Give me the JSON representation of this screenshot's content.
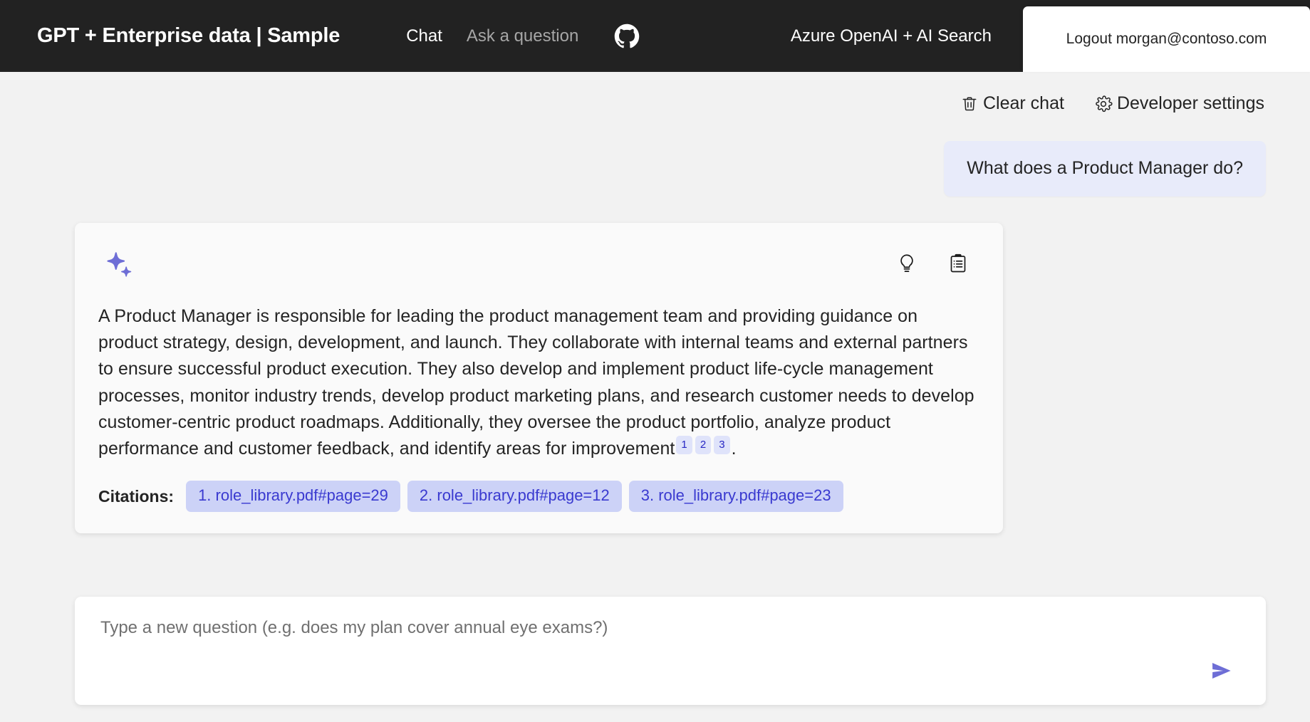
{
  "header": {
    "title": "GPT + Enterprise data | Sample",
    "nav": [
      {
        "label": "Chat",
        "active": true
      },
      {
        "label": "Ask a question",
        "active": false
      }
    ],
    "github_icon": "github-icon",
    "subtitle": "Azure OpenAI + AI Search",
    "logout_label": "Logout morgan@contoso.com"
  },
  "command_bar": {
    "clear_chat": {
      "label": "Clear chat",
      "icon": "trash-icon"
    },
    "developer_settings": {
      "label": "Developer settings",
      "icon": "gear-icon"
    }
  },
  "conversation": {
    "user_message": "What does a Product Manager do?",
    "answer": {
      "avatar_icon": "sparkle-icon",
      "actions": [
        {
          "name": "thought-process",
          "icon": "lightbulb-icon"
        },
        {
          "name": "supporting-content",
          "icon": "clipboard-icon"
        }
      ],
      "text_part_1": "A Product Manager is responsible for leading the product management team and providing guidance on product strategy, design, development, and launch. They collaborate with internal teams and external partners to ensure successful product execution. They also develop and implement product life-cycle management processes, monitor industry trends, develop product marketing plans, and research customer needs to develop customer-centric product roadmaps. Additionally, they oversee the product portfolio, analyze product performance and customer feedback, and identify areas for improvement",
      "sup_1": "1",
      "sup_2": "2",
      "sup_3": "3",
      "text_part_2": ".",
      "citations_label": "Citations:",
      "citations": [
        "1. role_library.pdf#page=29",
        "2. role_library.pdf#page=12",
        "3. role_library.pdf#page=23"
      ]
    }
  },
  "question_input": {
    "placeholder": "Type a new question (e.g. does my plan cover annual eye exams?)",
    "value": "",
    "send_icon": "send-arrow-icon"
  },
  "colors": {
    "header_bg": "#222222",
    "page_bg": "#f2f2f2",
    "accent_purple": "#6e6ed6",
    "user_bubble": "#e8ebfa",
    "citation_pill": "#ccd2f7",
    "citation_text": "#3a3ad0"
  }
}
